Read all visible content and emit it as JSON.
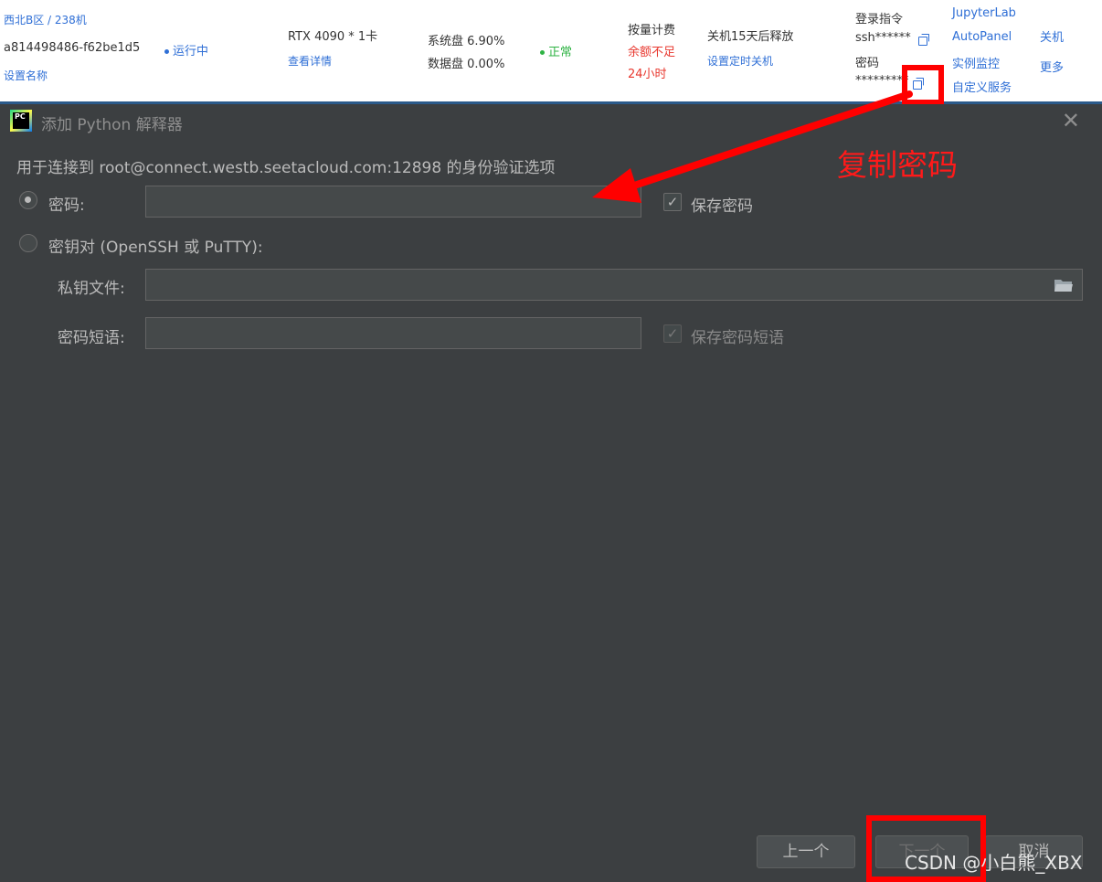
{
  "instance": {
    "region": "西北B区 / 238机",
    "id": "a814498486-f62be1d5",
    "set_name": "设置名称",
    "status": "运行中",
    "gpu": "RTX 4090 * 1卡",
    "view_details": "查看详情",
    "sys_disk": "系统盘 6.90%",
    "data_disk": "数据盘 0.00%",
    "health": "正常",
    "billing": "按量计费",
    "balance_warn": "余额不足",
    "balance_hours": "24小时",
    "release": "关机15天后释放",
    "set_timer": "设置定时关机",
    "login_cmd_label": "登录指令",
    "login_cmd_value": "ssh******",
    "password_label": "密码",
    "password_value": "*********",
    "links": [
      "JupyterLab",
      "AutoPanel",
      "实例监控",
      "自定义服务"
    ],
    "shutdown": "关机",
    "more": "更多",
    "colors": {
      "link": "#2f6fd6",
      "ok": "#2fb344",
      "warn": "#e8382f"
    }
  },
  "dialog": {
    "title": "添加 Python 解释器",
    "subtitle": "用于连接到 root@connect.westb.seetacloud.com:12898 的身份验证选项",
    "password_radio": "密码:",
    "password_value": "",
    "save_password": "保存密码",
    "keypair_radio": "密钥对 (OpenSSH 或 PuTTY):",
    "private_key_label": "私钥文件:",
    "private_key_value": "",
    "passphrase_label": "密码短语:",
    "passphrase_value": "",
    "save_passphrase": "保存密码短语",
    "prev": "上一个",
    "next": "下一个",
    "cancel": "取消"
  },
  "annotation": {
    "text": "复制密码",
    "color": "#ff0000"
  },
  "watermark": "CSDN @小白熊_XBX"
}
